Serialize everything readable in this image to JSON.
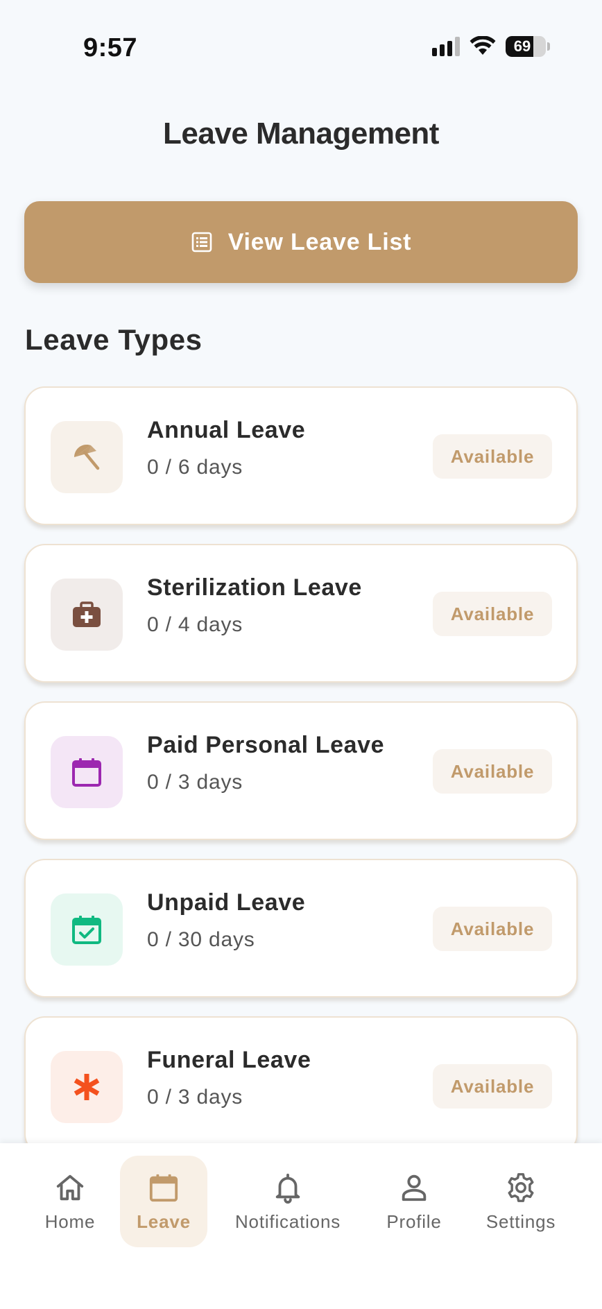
{
  "status_bar": {
    "time": "9:57",
    "battery": "69",
    "battery_level": 0.69
  },
  "header": {
    "title": "Leave Management"
  },
  "view_list_button": {
    "label": "View Leave List",
    "icon": "list-icon"
  },
  "section": {
    "title": "Leave Types"
  },
  "leave_types": [
    {
      "name": "Annual Leave",
      "days": "0 / 6 days",
      "status": "Available",
      "icon": "umbrella-icon",
      "icon_color": "#c19a6b",
      "icon_bg": "#f7f1ea"
    },
    {
      "name": "Sterilization Leave",
      "days": "0 / 4 days",
      "status": "Available",
      "icon": "medical-kit-icon",
      "icon_color": "#7a4f40",
      "icon_bg": "#f1ecea"
    },
    {
      "name": "Paid Personal Leave",
      "days": "0 / 3 days",
      "status": "Available",
      "icon": "calendar-icon",
      "icon_color": "#9c27b0",
      "icon_bg": "#f4e6f6"
    },
    {
      "name": "Unpaid Leave",
      "days": "0 / 30 days",
      "status": "Available",
      "icon": "calendar-check-icon",
      "icon_color": "#10b981",
      "icon_bg": "#e7f8f1"
    },
    {
      "name": "Funeral Leave",
      "days": "0 / 3 days",
      "status": "Available",
      "icon": "asterisk-icon",
      "icon_color": "#f4511e",
      "icon_bg": "#fdeee8"
    }
  ],
  "bottom_nav": {
    "items": [
      {
        "label": "Home",
        "icon": "home-icon",
        "active": false
      },
      {
        "label": "Leave",
        "icon": "calendar-icon",
        "active": true
      },
      {
        "label": "Notifications",
        "icon": "bell-icon",
        "active": false
      },
      {
        "label": "Profile",
        "icon": "person-icon",
        "active": false
      },
      {
        "label": "Settings",
        "icon": "gear-icon",
        "active": false
      }
    ]
  },
  "colors": {
    "accent": "#c19a6b",
    "background": "#f6f9fc",
    "badge_bg": "#f8f3ee",
    "card_border": "#eee2d2"
  }
}
